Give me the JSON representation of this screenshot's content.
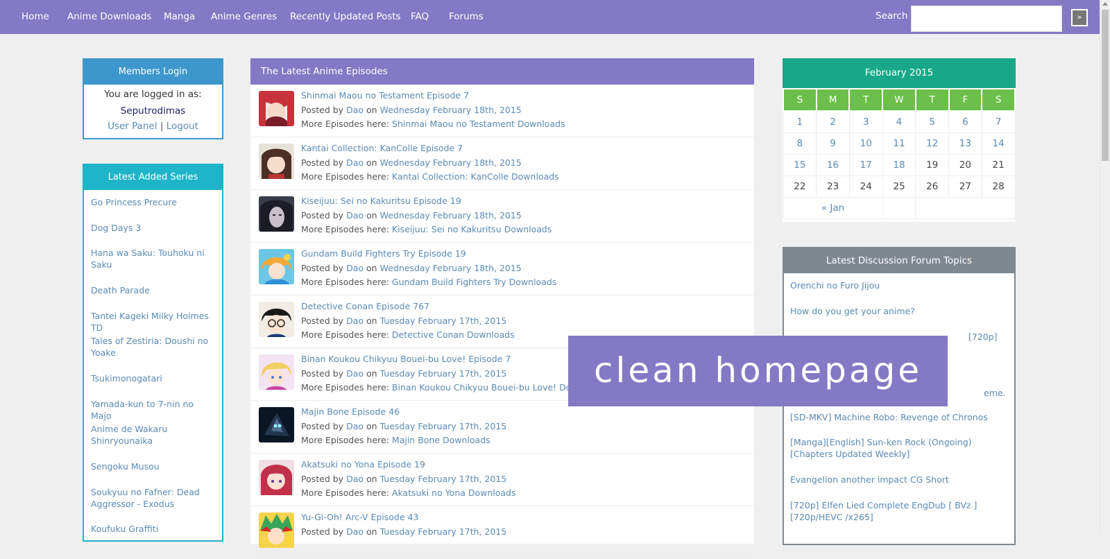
{
  "nav": {
    "items": [
      "Home",
      "Anime Downloads",
      "Manga",
      "Anime Genres",
      "Recently Updated Posts",
      "FAQ",
      "Forums"
    ],
    "search_label": "Search",
    "search_button": "»",
    "bg_color": "#8479c4"
  },
  "login": {
    "title": "Members Login",
    "logged_in_text": "You are logged in as:",
    "username": "Seputrodimas",
    "user_panel": "User Panel",
    "separator": "|",
    "logout": "Logout"
  },
  "series": {
    "title": "Latest Added Series",
    "items": [
      "Go Princess Precure",
      "Dog Days 3",
      "Hana wa Saku: Touhoku ni Saku",
      "Death Parade",
      "Tantei Kageki Milky Holmes TD",
      "Tales of Zestiria: Doushi no Yoake",
      "Tsukimonogatari",
      "Yamada-kun to 7-nin no Majo",
      "Anime de Wakaru Shinryounaika",
      "Sengoku Musou",
      "Soukyuu no Fafner: Dead Aggressor - Exodus",
      "Koufuku Graffiti"
    ]
  },
  "episodes": {
    "title": "The Latest Anime Episodes",
    "posted_by": "Posted by",
    "on": "on",
    "more_label": "More Episodes here:",
    "items": [
      {
        "title": "Shinmai Maou no Testament Episode 7",
        "author": "Dao",
        "date": "Wednesday February 18th, 2015",
        "more": "Shinmai Maou no Testament Downloads",
        "thumb": "red-hair-girl"
      },
      {
        "title": "Kantai Collection: KanColle Episode 7",
        "author": "Dao",
        "date": "Wednesday February 18th, 2015",
        "more": "Kantai Collection: KanColle Downloads",
        "thumb": "brown-hair-girl"
      },
      {
        "title": "Kiseijuu: Sei no Kakuritsu Episode 19",
        "author": "Dao",
        "date": "Wednesday February 18th, 2015",
        "more": "Kiseijuu: Sei no Kakuritsu Downloads",
        "thumb": "dark-hair-woman"
      },
      {
        "title": "Gundam Build Fighters Try Episode 19",
        "author": "Dao",
        "date": "Wednesday February 18th, 2015",
        "more": "Gundam Build Fighters Try Downloads",
        "thumb": "orange-hair-girl"
      },
      {
        "title": "Detective Conan Episode 767",
        "author": "Dao",
        "date": "Tuesday February 17th, 2015",
        "more": "Detective Conan Downloads",
        "thumb": "glasses-boy"
      },
      {
        "title": "Binan Koukou Chikyuu Bouei-bu Love! Episode 7",
        "author": "Dao",
        "date": "Tuesday February 17th, 2015",
        "more": "Binan Koukou Chikyuu Bouei-bu Love! Downloads",
        "thumb": "blonde-boy"
      },
      {
        "title": "Majin Bone Episode 46",
        "author": "Dao",
        "date": "Tuesday February 17th, 2015",
        "more": "Majin Bone Downloads",
        "thumb": "dark-figure"
      },
      {
        "title": "Akatsuki no Yona Episode 19",
        "author": "Dao",
        "date": "Tuesday February 17th, 2015",
        "more": "Akatsuki no Yona Downloads",
        "thumb": "red-hair-princess"
      },
      {
        "title": "Yu-Gi-Oh! Arc-V Episode 43",
        "author": "Dao",
        "date": "Tuesday February 17th, 2015",
        "more": "",
        "thumb": "green-hair-boy"
      }
    ]
  },
  "calendar": {
    "title": "February 2015",
    "weekdays": [
      "S",
      "M",
      "T",
      "W",
      "T",
      "F",
      "S"
    ],
    "weeks": [
      [
        "1",
        "2",
        "3",
        "4",
        "5",
        "6",
        "7"
      ],
      [
        "8",
        "9",
        "10",
        "11",
        "12",
        "13",
        "14"
      ],
      [
        "15",
        "16",
        "17",
        "18",
        "19",
        "20",
        "21"
      ],
      [
        "22",
        "23",
        "24",
        "25",
        "26",
        "27",
        "28"
      ]
    ],
    "prev_link": "« Jan"
  },
  "forum": {
    "title": "Latest Discussion Forum Topics",
    "items": [
      "Orenchi no Furo Jijou",
      "How do you get your anime?",
      "[720p]",
      "eme.",
      "[SD-MKV] Machine Robo: Revenge of Chronos",
      "[Manga][English] Sun-ken Rock (Ongoing) [Chapters Updated Weekly]",
      "Evangelion another impact CG Short",
      "[720p] Elfen Lied Complete EngDub [ BVz ][720p/HEVC /x265]"
    ]
  },
  "banner": {
    "text": "clean homepage"
  }
}
